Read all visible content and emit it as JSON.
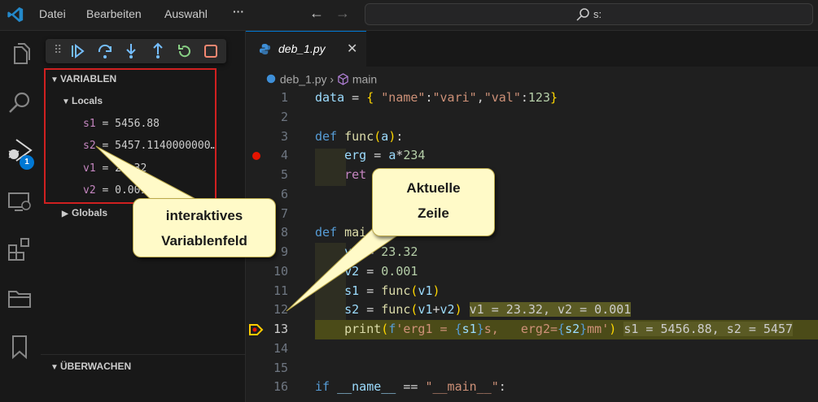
{
  "titlebar": {
    "menu": [
      "Datei",
      "Bearbeiten",
      "Auswahl",
      "···"
    ],
    "search": "s:"
  },
  "activity": [
    "explorer-icon",
    "search-icon",
    "run-debug-icon",
    "remote-explorer-icon",
    "extensions-icon",
    "folders-icon",
    "bookmarks-icon"
  ],
  "debug_badge": "1",
  "sidebar": {
    "variables_header": "VARIABLEN",
    "locals_label": "Locals",
    "variables": [
      {
        "name": "s1",
        "value": " = 5456.88"
      },
      {
        "name": "s2",
        "value": " = 5457.1140000000…"
      },
      {
        "name": "v1",
        "value": " = 23.32"
      },
      {
        "name": "v2",
        "value": " = 0.001"
      }
    ],
    "globals_label": "Globals",
    "watch_header": "ÜBERWACHEN"
  },
  "editor": {
    "tab_label": "deb_1.py",
    "tab_close": "✕",
    "breadcrumb_file": "deb_1.py",
    "breadcrumb_symbol": "main",
    "line_numbers": [
      "1",
      "2",
      "3",
      "4",
      "5",
      "6",
      "7",
      "8",
      "9",
      "10",
      "11",
      "12",
      "13",
      "14",
      "15",
      "16"
    ]
  },
  "callouts": {
    "variablen": [
      "interaktives",
      "Variablenfeld"
    ],
    "zeile": [
      "Aktuelle",
      "Zeile"
    ]
  },
  "colors": {
    "accent": "#0078d4",
    "breakpoint": "#e51400",
    "current_line": "#4b4b18",
    "highlight_box": "#d02020",
    "callout": "#fffac8"
  }
}
